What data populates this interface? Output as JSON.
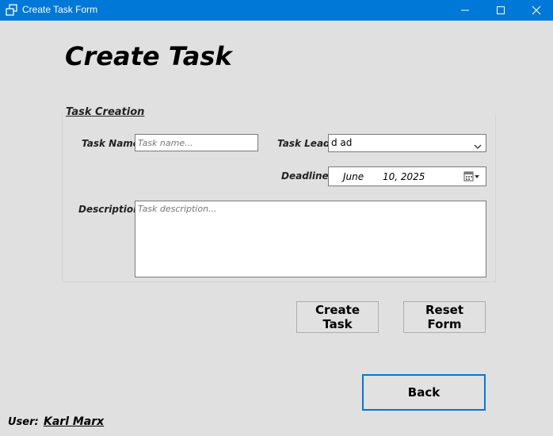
{
  "window": {
    "title": "Create Task Form",
    "icons": [
      "app-icon",
      "minimize-icon",
      "maximize-icon",
      "close-icon"
    ]
  },
  "page": {
    "heading": "Create Task"
  },
  "group": {
    "label": "Task Creation"
  },
  "form": {
    "task_name_label": "Task Name",
    "task_name_placeholder": "Task name...",
    "task_name_value": "",
    "task_lead_label": "Task Lead",
    "task_lead_value": "d ad",
    "deadline_label": "Deadline",
    "deadline_month": "June",
    "deadline_day_year": "10, 2025",
    "description_label": "Description",
    "description_placeholder": "Task description...",
    "description_value": ""
  },
  "buttons": {
    "create": "Create Task",
    "reset": "Reset Form",
    "back": "Back"
  },
  "user": {
    "label": "User:",
    "name": "Karl Marx"
  },
  "colors": {
    "titlebar": "#0078d7",
    "background": "#e0e0e0",
    "focus_border": "#0078d7"
  }
}
